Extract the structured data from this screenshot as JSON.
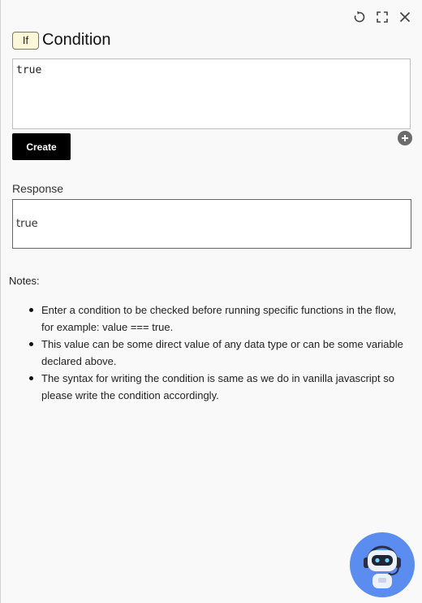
{
  "header": {
    "icons": [
      "refresh-icon",
      "fullscreen-icon",
      "close-icon"
    ]
  },
  "node": {
    "badge": "If",
    "title": "Condition"
  },
  "editor": {
    "value": "true"
  },
  "actions": {
    "create_label": "Create"
  },
  "response": {
    "label": "Response",
    "value": "true"
  },
  "notes": {
    "heading": "Notes:",
    "items": [
      "Enter a condition to be checked before running specific functions in the flow, for example: value === true.",
      "This value can be some direct value of any data type or can be some variable declared above.",
      "The syntax for writing the condition is same as we do in vanilla javascript so please write the condition accordingly."
    ]
  },
  "colors": {
    "background": "#f9f9f9",
    "badge_bg": "#fbf7d9",
    "button_bg": "#000000",
    "bot_bg": "#5b8df0"
  }
}
